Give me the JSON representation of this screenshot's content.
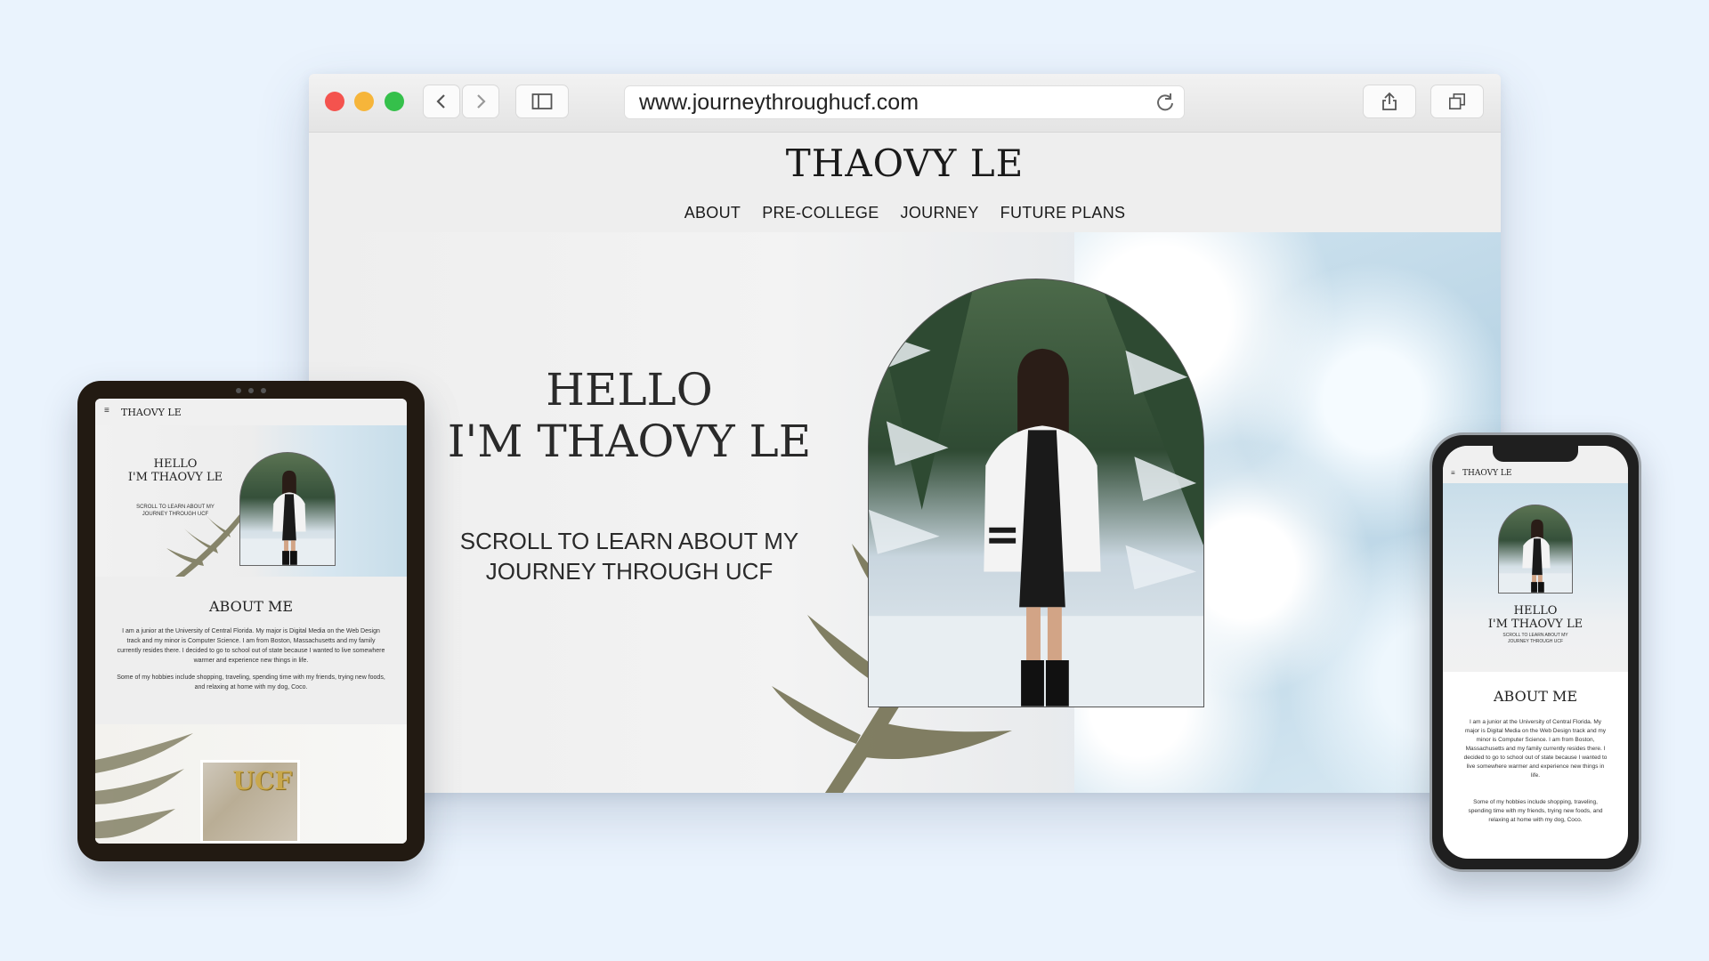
{
  "browser": {
    "url": "www.journeythroughucf.com",
    "icons": {
      "back": "chevron-left-icon",
      "forward": "chevron-right-icon",
      "sidebar": "sidebar-icon",
      "reload": "reload-icon",
      "share": "share-icon",
      "tabs": "tabs-icon"
    }
  },
  "site": {
    "title": "THAOVY LE",
    "nav": [
      "ABOUT",
      "PRE-COLLEGE",
      "JOURNEY",
      "FUTURE PLANS"
    ],
    "hero": {
      "hello_line1": "HELLO",
      "hello_line2": "I'M THAOVY LE",
      "sub_line1": "SCROLL TO LEARN ABOUT MY",
      "sub_line2": "JOURNEY THROUGH UCF"
    }
  },
  "tablet": {
    "menu_icon": "≡",
    "title": "THAOVY LE",
    "hello_line1": "HELLO",
    "hello_line2": "I'M THAOVY LE",
    "scroll_line1": "SCROLL TO LEARN ABOUT MY",
    "scroll_line2": "JOURNEY THROUGH UCF",
    "about_heading": "ABOUT ME",
    "about_p1": "I am a junior at the University of Central Florida. My major is Digital Media on the Web Design track and my minor is Computer Science. I am from Boston, Massachusetts and my family currently resides there. I decided to go to school out of state because I wanted to live somewhere warmer and experience new things in life.",
    "about_p2": "Some of my hobbies include shopping, traveling, spending time with my friends, trying new foods, and relaxing at home with my dog, Coco.",
    "photo_text": "UCF"
  },
  "phone": {
    "menu_icon": "≡",
    "title": "THAOVY LE",
    "hello_line1": "HELLO",
    "hello_line2": "I'M THAOVY LE",
    "scroll_line1": "SCROLL TO LEARN ABOUT MY",
    "scroll_line2": "JOURNEY THROUGH UCF",
    "about_heading": "ABOUT ME",
    "about_p1": "I am a junior at the University of Central Florida. My major is Digital Media on the Web Design track and my minor is Computer Science. I am from Boston, Massachusetts and my family currently resides there. I decided to go to school out of state because I wanted to live somewhere warmer and experience new things in life.",
    "about_p2": "Some of my hobbies include shopping, traveling, spending time with my friends, trying new foods, and relaxing at home with my dog, Coco."
  },
  "colors": {
    "background": "#eaf3fd",
    "traffic_red": "#f4534e",
    "traffic_yellow": "#f6b53a",
    "traffic_green": "#35c04b",
    "text_dark": "#1a1a1a"
  }
}
